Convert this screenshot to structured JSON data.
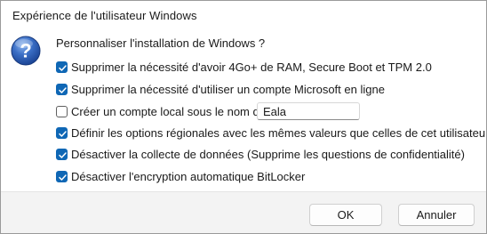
{
  "window": {
    "title": "Expérience de l'utilisateur Windows"
  },
  "dialog": {
    "icon": "question-icon",
    "heading": "Personnaliser l'installation de Windows ?",
    "options": [
      {
        "label": "Supprimer la nécessité d'avoir 4Go+ de RAM, Secure Boot et TPM 2.0",
        "checked": true
      },
      {
        "label": "Supprimer la nécessité d'utiliser un compte Microsoft en ligne",
        "checked": true
      },
      {
        "label": "Créer un compte local sous le nom de :",
        "checked": false
      },
      {
        "label": "Définir les options régionales avec les mêmes valeurs que celles de cet utilisateur",
        "checked": true
      },
      {
        "label": "Désactiver la collecte de données (Supprime les questions de confidentialité)",
        "checked": true
      },
      {
        "label": "Désactiver l'encryption automatique BitLocker",
        "checked": true
      }
    ],
    "local_account_name": "Eala"
  },
  "buttons": {
    "ok_label": "OK",
    "cancel_label": "Annuler"
  },
  "colors": {
    "checkbox_accent": "#0f67b5",
    "icon_blue": "#1f4fa8"
  }
}
